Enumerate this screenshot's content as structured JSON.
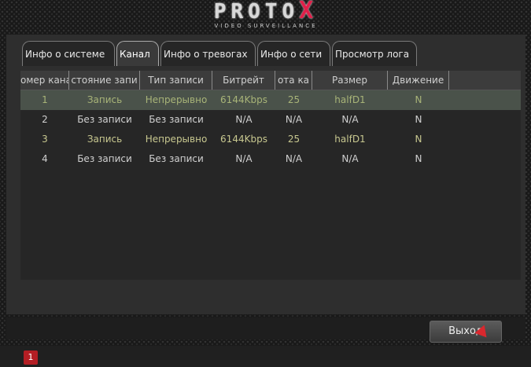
{
  "header": {
    "brand": "PROTO",
    "brand_x": "X",
    "subtitle": "VIDEO SURVEILLANCE"
  },
  "tabs": [
    {
      "label": "Инфо о системе",
      "active": false
    },
    {
      "label": "Канал",
      "active": true
    },
    {
      "label": "Инфо о тревогах",
      "active": false
    },
    {
      "label": "Инфо о сети",
      "active": false
    },
    {
      "label": "Просмотр лога",
      "active": false
    }
  ],
  "table": {
    "headers": [
      "омер кана",
      "стояние запи",
      "Тип записи",
      "Битрейт",
      "ота ка",
      "Размер",
      "Движение"
    ],
    "rows": [
      [
        "1",
        "Запись",
        "Непрерывно",
        "6144Kbps",
        "25",
        "halfD1",
        "N"
      ],
      [
        "2",
        "Без записи",
        "Без записи",
        "N/A",
        "N/A",
        "N/A",
        "N"
      ],
      [
        "3",
        "Запись",
        "Непрерывно",
        "6144Kbps",
        "25",
        "halfD1",
        "N"
      ],
      [
        "4",
        "Без записи",
        "Без записи",
        "N/A",
        "N/A",
        "N/A",
        "N"
      ]
    ]
  },
  "exit_label": "Выход",
  "status": {
    "icon_label": "1"
  },
  "colors": {
    "cursor": "#d9282e",
    "status_icon": "#b31e24",
    "brand_x": "#e0204a"
  }
}
